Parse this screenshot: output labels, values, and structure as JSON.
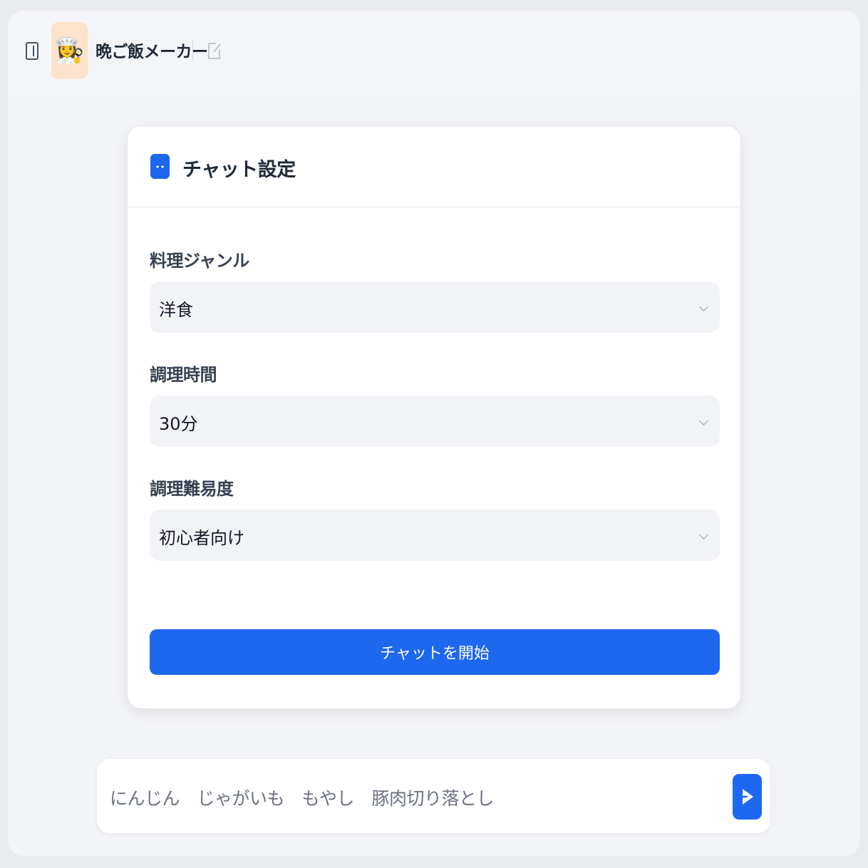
{
  "header": {
    "app_icon": "👩‍🍳",
    "title": "晩ご飯メーカー",
    "icons": [
      "sidebar-toggle-icon",
      "edit-icon"
    ]
  },
  "settings": {
    "title": "チャット設定",
    "fields": [
      {
        "label": "料理ジャンル",
        "value": "洋食"
      },
      {
        "label": "調理時間",
        "value": "30分"
      },
      {
        "label": "調理難易度",
        "value": "初心者向け"
      }
    ],
    "start_button": "チャットを開始"
  },
  "composer": {
    "input_value": "にんじん　じゃがいも　もやし　豚肉切り落とし"
  },
  "colors": {
    "accent": "#1e67ef",
    "background": "#f3f4f7",
    "app_icon_bg": "#fde2cc"
  }
}
